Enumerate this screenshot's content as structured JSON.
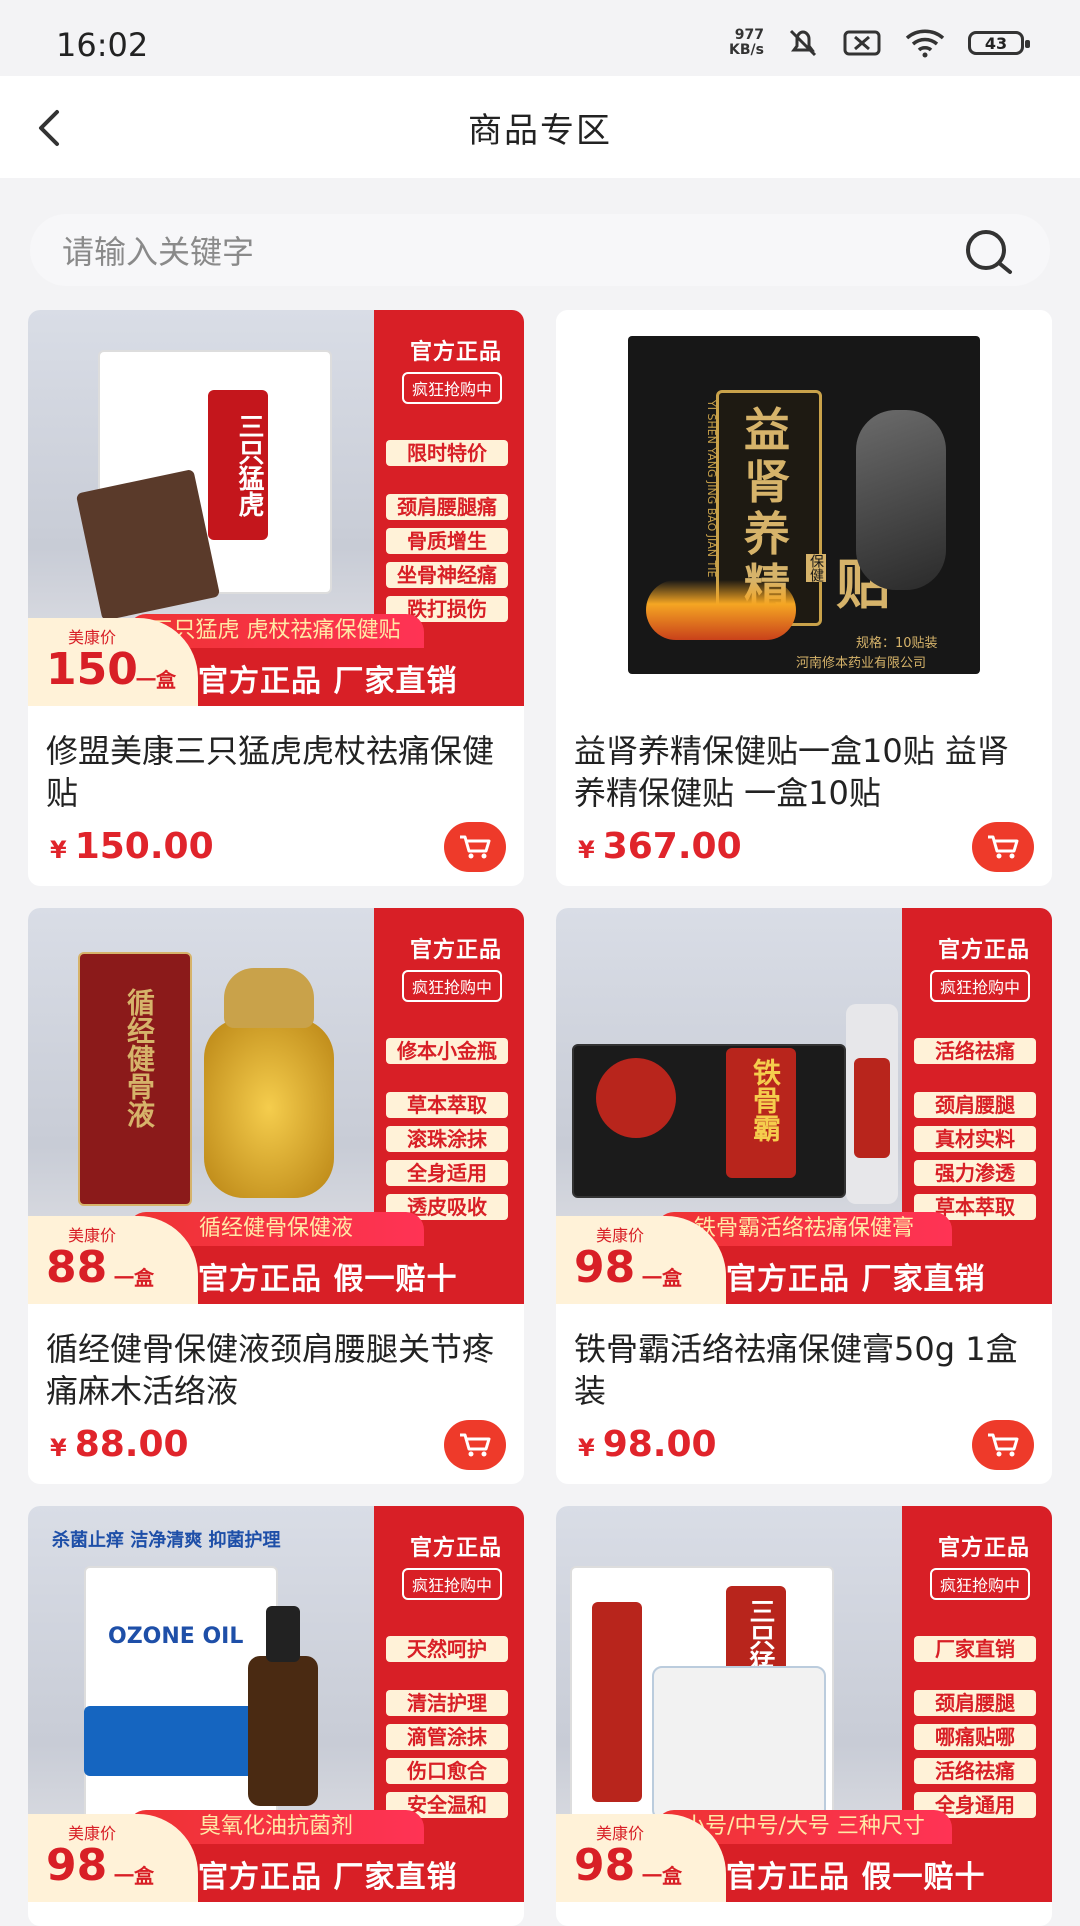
{
  "status": {
    "time": "16:02",
    "net_speed": "977\nKB/s",
    "battery": "43"
  },
  "header": {
    "title": "商品专区"
  },
  "search": {
    "placeholder": "请输入关键字"
  },
  "currency_symbol": "¥",
  "products": [
    {
      "name": "修盟美康三只猛虎虎杖祛痛保健贴",
      "price": "150.00",
      "promo": {
        "side_top": "官方正品",
        "side_chip": "疯狂抢购中",
        "tags": [
          "限时特价",
          "颈肩腰腿痛",
          "骨质增生",
          "坐骨神经痛",
          "跌打损伤"
        ],
        "banner": "三只猛虎 虎杖祛痛保健贴",
        "badge_label": "美康价",
        "badge_price": "150",
        "badge_unit": "一盒",
        "strip": "官方正品 厂家直销"
      }
    },
    {
      "name": "益肾养精保健贴一盒10贴 益肾养精保健贴 一盒10贴",
      "price": "367.00",
      "promo": {
        "box_title": "益肾养精",
        "box_subtitle": "保健",
        "box_title_tail": "贴",
        "box_pinyin": "YI SHEN YANG JING BAO JIAN TIE",
        "box_spec": "规格：10贴装",
        "box_company": "河南修本药业有限公司"
      }
    },
    {
      "name": "循经健骨保健液颈肩腰腿关节疼痛麻木活络液",
      "price": "88.00",
      "promo": {
        "side_top": "官方正品",
        "side_chip": "疯狂抢购中",
        "tags": [
          "修本小金瓶",
          "草本萃取",
          "滚珠涂抹",
          "全身适用",
          "透皮吸收"
        ],
        "banner": "循经健骨保健液",
        "badge_label": "美康价",
        "badge_price": "88",
        "badge_unit": "一盒",
        "strip": "官方正品 假一赔十",
        "box_text": "循经健骨液"
      }
    },
    {
      "name": "铁骨霸活络祛痛保健膏50g 1盒装",
      "price": "98.00",
      "promo": {
        "side_top": "官方正品",
        "side_chip": "疯狂抢购中",
        "tags": [
          "活络祛痛",
          "颈肩腰腿",
          "真材实料",
          "强力渗透",
          "草本萃取"
        ],
        "banner": "铁骨霸活络祛痛保健膏",
        "badge_label": "美康价",
        "badge_price": "98",
        "badge_unit": "一盒",
        "strip": "官方正品 厂家直销",
        "box_text": "铁骨霸"
      }
    },
    {
      "name": "",
      "price": "",
      "promo": {
        "top_text": "杀菌止痒 洁净清爽 抑菌护理",
        "side_top": "官方正品",
        "side_chip": "疯狂抢购中",
        "tags": [
          "天然呵护",
          "清洁护理",
          "滴管涂抹",
          "伤口愈合",
          "安全温和"
        ],
        "banner": "臭氧化油抗菌剂",
        "badge_label": "美康价",
        "badge_price": "98",
        "badge_unit": "一盒",
        "strip": "官方正品 厂家直销",
        "box_text": "OZONE OIL"
      }
    },
    {
      "name": "",
      "price": "",
      "promo": {
        "side_top": "官方正品",
        "side_chip": "疯狂抢购中",
        "tags": [
          "厂家直销",
          "颈肩腰腿",
          "哪痛贴哪",
          "活络祛痛",
          "全身通用"
        ],
        "banner": "小号/中号/大号 三种尺寸",
        "badge_label": "美康价",
        "badge_price": "98",
        "badge_unit": "一盒",
        "strip": "官方正品 假一赔十",
        "box_text": "三只猛虎"
      }
    }
  ]
}
